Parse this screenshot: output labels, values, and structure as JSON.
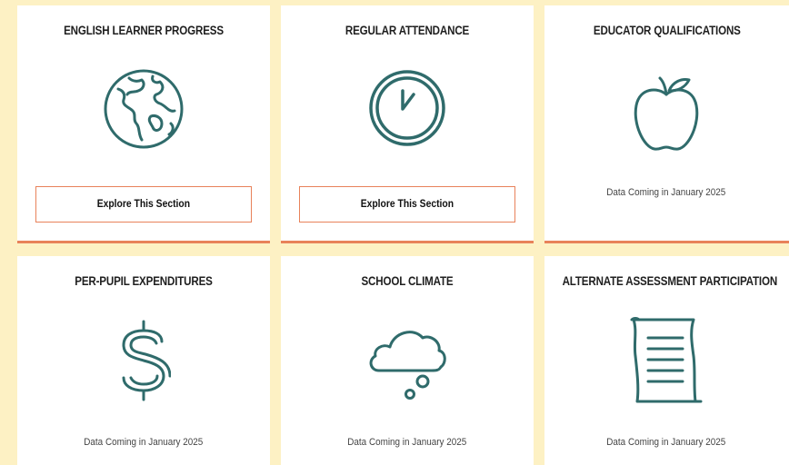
{
  "cards": [
    {
      "title": "ENGLISH LEARNER PROGRESS",
      "icon": "globe-icon",
      "button_label": "Explore This Section"
    },
    {
      "title": "REGULAR ATTENDANCE",
      "icon": "clock-icon",
      "button_label": "Explore This Section"
    },
    {
      "title": "EDUCATOR QUALIFICATIONS",
      "icon": "apple-icon",
      "note": "Data Coming in January 2025"
    },
    {
      "title": "PER-PUPIL EXPENDITURES",
      "icon": "dollar-sign-icon",
      "note": "Data Coming in January 2025"
    },
    {
      "title": "SCHOOL CLIMATE",
      "icon": "thought-cloud-icon",
      "note": "Data Coming in January 2025"
    },
    {
      "title": "ALTERNATE ASSESSMENT PARTICIPATION",
      "icon": "document-scroll-icon",
      "note": "Data Coming in January 2025"
    }
  ],
  "colors": {
    "background": "#fdf1c4",
    "icon_stroke": "#2f6b6b",
    "accent": "#e8825a"
  }
}
